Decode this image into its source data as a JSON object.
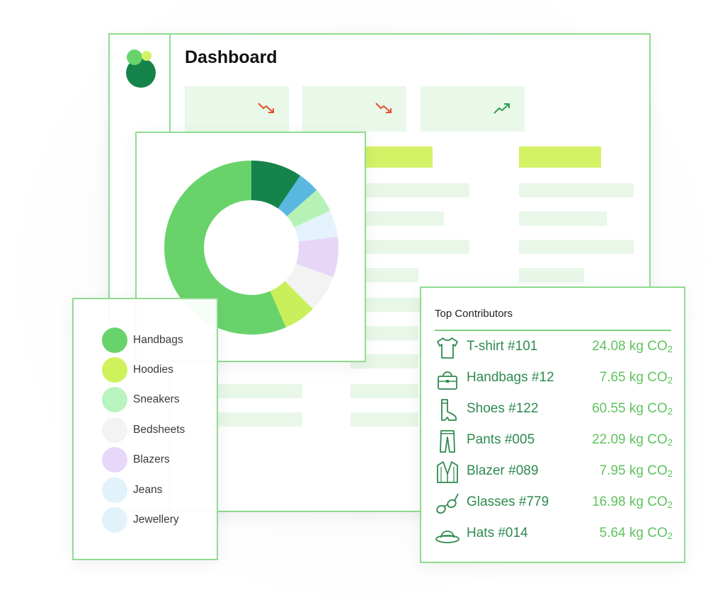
{
  "dashboard": {
    "title": "Dashboard",
    "stat_cards": [
      {
        "trend": "down",
        "trend_icon": "trend-down-icon",
        "color": "#e2502a"
      },
      {
        "trend": "down",
        "trend_icon": "trend-down-icon",
        "color": "#e2502a"
      },
      {
        "trend": "up",
        "trend_icon": "trend-up-icon",
        "color": "#2e9a4f"
      }
    ]
  },
  "colors": {
    "border": "#8fdc8f",
    "brand_dark": "#16834a",
    "brand_light": "#6ad36a",
    "lime": "#d4f266",
    "value_green": "#5fc35f",
    "name_green": "#2e8a4f"
  },
  "chart_data": {
    "type": "pie",
    "donut": true,
    "slices": [
      {
        "label": "",
        "value": 9.5,
        "color": "#16834a"
      },
      {
        "label": "",
        "value": 4.0,
        "color": "#5ab7e0"
      },
      {
        "label": "",
        "value": 4.5,
        "color": "#b6f2b6"
      },
      {
        "label": "",
        "value": 5.0,
        "color": "#e4f3fb"
      },
      {
        "label": "",
        "value": 7.5,
        "color": "#e7d6f7"
      },
      {
        "label": "",
        "value": 7.0,
        "color": "#f2f3f2"
      },
      {
        "label": "",
        "value": 6.0,
        "color": "#c9f05a"
      },
      {
        "label": "",
        "value": 56.5,
        "color": "#69d36b"
      }
    ]
  },
  "legend": {
    "items": [
      {
        "label": "Handbags",
        "color": "#69d36b"
      },
      {
        "label": "Hoodies",
        "color": "#cff25c"
      },
      {
        "label": "Sneakers",
        "color": "#b9f3c0"
      },
      {
        "label": "Bedsheets",
        "color": "#f2f3f2"
      },
      {
        "label": "Blazers",
        "color": "#e8d7f8"
      },
      {
        "label": "Jeans",
        "color": "#e1f2fb"
      },
      {
        "label": "Jewellery",
        "color": "#e1f2fb"
      }
    ]
  },
  "contributors": {
    "title": "Top Contributors",
    "unit_prefix": "kg CO",
    "unit_sub": "2",
    "rows": [
      {
        "icon": "tshirt-icon",
        "name": "T-shirt #101",
        "value": "24.08"
      },
      {
        "icon": "handbag-icon",
        "name": "Handbags #12",
        "value": "7.65"
      },
      {
        "icon": "boot-icon",
        "name": "Shoes #122",
        "value": "60.55"
      },
      {
        "icon": "pants-icon",
        "name": "Pants #005",
        "value": "22.09"
      },
      {
        "icon": "blazer-icon",
        "name": "Blazer #089",
        "value": "7.95"
      },
      {
        "icon": "glasses-icon",
        "name": "Glasses #779",
        "value": "16.98"
      },
      {
        "icon": "hat-icon",
        "name": "Hats #014",
        "value": "5.64"
      }
    ]
  }
}
